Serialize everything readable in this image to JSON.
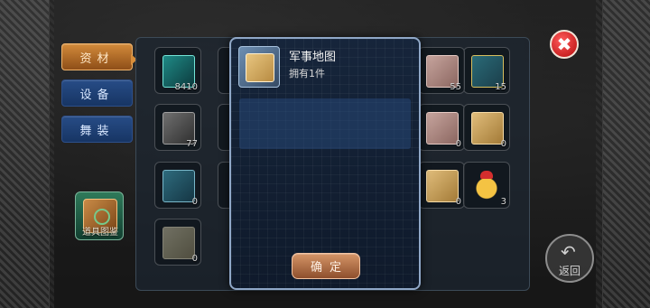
{
  "tabs": [
    {
      "label": "资材",
      "active": true
    },
    {
      "label": "设备",
      "active": false
    },
    {
      "label": "舞装",
      "active": false
    }
  ],
  "codex_label": "道具图鉴",
  "close_icon": "✖",
  "return_label": "返回",
  "return_icon": "↶",
  "modal": {
    "title": "军事地图",
    "owned": "拥有1件",
    "confirm": "确定"
  },
  "grid_counts": {
    "r1c1": "8410",
    "r1c6": "55",
    "r1c7": "15",
    "r2c1": "77",
    "r2c6": "0",
    "r2c7": "0",
    "r3c1": "0",
    "r3c6": "0",
    "r3c7": "3",
    "r4c1": "0"
  }
}
